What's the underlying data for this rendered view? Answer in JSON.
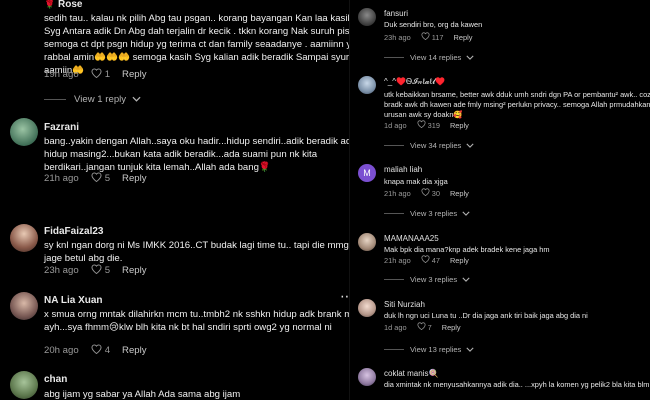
{
  "left_column": {
    "comments": [
      {
        "author": "Rose",
        "text": "sedih tau.. kalau nk pilih Abg tau psgan.. korang bayangan Kan laa kasih Syg Antara adik Dn Abg dah terjalin dr kecik . tkkn korang Nak suruh pisah. semoga ct dpt psgn hidup yg terima ct dan family seaadanye . aamiinn ya rabbal amin🤲🤲🤲 semoga kasih Syg kalian adik beradik Sampai syurga aamiin🤲",
        "time": "19h ago",
        "likes": "1",
        "reply_label": "Reply",
        "view_replies": "View 1 reply"
      },
      {
        "author": "Fazrani",
        "text": "bang..yakin dengan Allah..saya oku hadir...hidup sendiri..adik beradik ada hidup masing2...bukan kata adik beradik...ada suami pun nk kita berdikari..jangan tunjuk kita lemah..Allah ada bang🌹",
        "time": "21h ago",
        "likes": "5",
        "reply_label": "Reply"
      },
      {
        "author": "FidaFaizal23",
        "text": "sy knl ngan dorg ni Ms IMKK 2016..CT budak lagi time tu.. tapi die mmg jage betul abg die.",
        "time": "23h ago",
        "likes": "5",
        "reply_label": "Reply"
      },
      {
        "author": "NA Lia Xuan",
        "text": "x smua orng mntak dilahirkn mcm tu..tmbh2 nk sshkn hidup adk brank mak ayh...sya fhmm😢klw blh kita nk bt hal sndiri sprti owg2 yg normal ni",
        "time": "20h ago",
        "likes": "4",
        "reply_label": "Reply"
      },
      {
        "author": "chan",
        "text": "abg ijam yg sabar ya Allah Ada sama abg ijam"
      }
    ]
  },
  "right_column": {
    "comments": [
      {
        "author": "fansuri",
        "text": "Duk sendiri bro, org da kawen",
        "time": "23h ago",
        "likes": "117",
        "reply_label": "Reply",
        "view_replies": "View 14 replies"
      },
      {
        "author": "^_^♥️Ѳ𝓘𝓃ℓ𝓪ℓ𝓵♥️",
        "text": "utk kebaikkan brsame, better awk dduk umh sndri dgn PA or pembantu² awk.. coz adk bradk awk dh kawen ade fmly msing² perlukn privacy.. semoga Allah prmudahkan urusan awk sy doakn🥰",
        "time": "1d ago",
        "likes": "319",
        "reply_label": "Reply",
        "view_replies": "View 34 replies"
      },
      {
        "author": "maliah liah",
        "text": "knapa mak dia xjga",
        "time": "21h ago",
        "likes": "30",
        "reply_label": "Reply",
        "view_replies": "View 3 replies"
      },
      {
        "author": "MAMANAAA25",
        "text": "Mak bpk dia mana?knp adek bradek kene jaga hm",
        "time": "21h ago",
        "likes": "47",
        "reply_label": "Reply",
        "view_replies": "View 3 replies"
      },
      {
        "author": "Siti Nurziah",
        "text": "duk lh ngn uci Luna tu ..Dr dia jaga ank tiri baik jaga abg dia ni",
        "time": "1d ago",
        "likes": "7",
        "reply_label": "Reply",
        "view_replies": "View 13 replies"
      },
      {
        "author": "coklat manis🍭",
        "text": "dia xmintak nk menyusahkannya adik dia.. ...xpyh la komen yg pelik2 bla kita blm diuji"
      }
    ]
  },
  "icons": {
    "heart": "heart-outline-icon",
    "chevron": "chevron-down-icon",
    "more": "more-options-icon"
  },
  "colors": {
    "background": "#000000",
    "text": "#f0f0f0",
    "muted": "#9a9a9a"
  }
}
